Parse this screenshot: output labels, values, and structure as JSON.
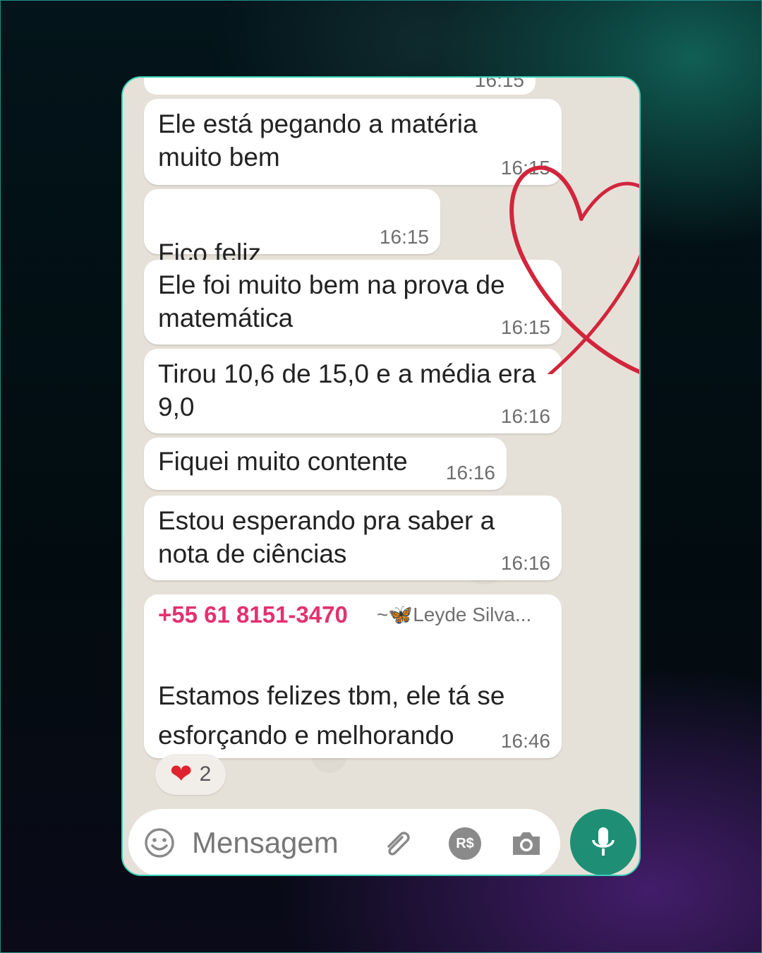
{
  "top_partial_time": "16:15",
  "messages": [
    {
      "text": "Ele está pegando a matéria\nmuito bem",
      "time": "16:15"
    },
    {
      "text": "Fico feliz",
      "emoji": "✨✨",
      "time": "16:15"
    },
    {
      "text": "Ele foi muito bem na prova de\nmatemática",
      "time": "16:15"
    },
    {
      "text": "Tirou 10,6 de 15,0 e a média era\n9,0",
      "time": "16:16"
    },
    {
      "text": "Fiquei muito contente",
      "time": "16:16"
    },
    {
      "text": "Estou esperando pra saber a\nnota de ciências",
      "time": "16:16"
    }
  ],
  "reply": {
    "sender_number": "+55 61 8151-3470",
    "sender_name": "~🦋Leyde Silva...",
    "text": "Estamos felizes tbm, ele tá se\nesforçando e melhorando",
    "emoji": "😊",
    "time": "16:46"
  },
  "reaction": {
    "emoji": "❤",
    "count": "2"
  },
  "composer": {
    "placeholder": "Mensagem",
    "currency_label": "R$",
    "icons": [
      "emoji-icon",
      "attach-icon",
      "payment-icon",
      "camera-icon",
      "mic-icon"
    ]
  },
  "colors": {
    "frame_border": "#3ad1b8",
    "sender": "#e4316f",
    "mic_button": "#1e8f74",
    "heart_doodle": "#d2253c"
  }
}
